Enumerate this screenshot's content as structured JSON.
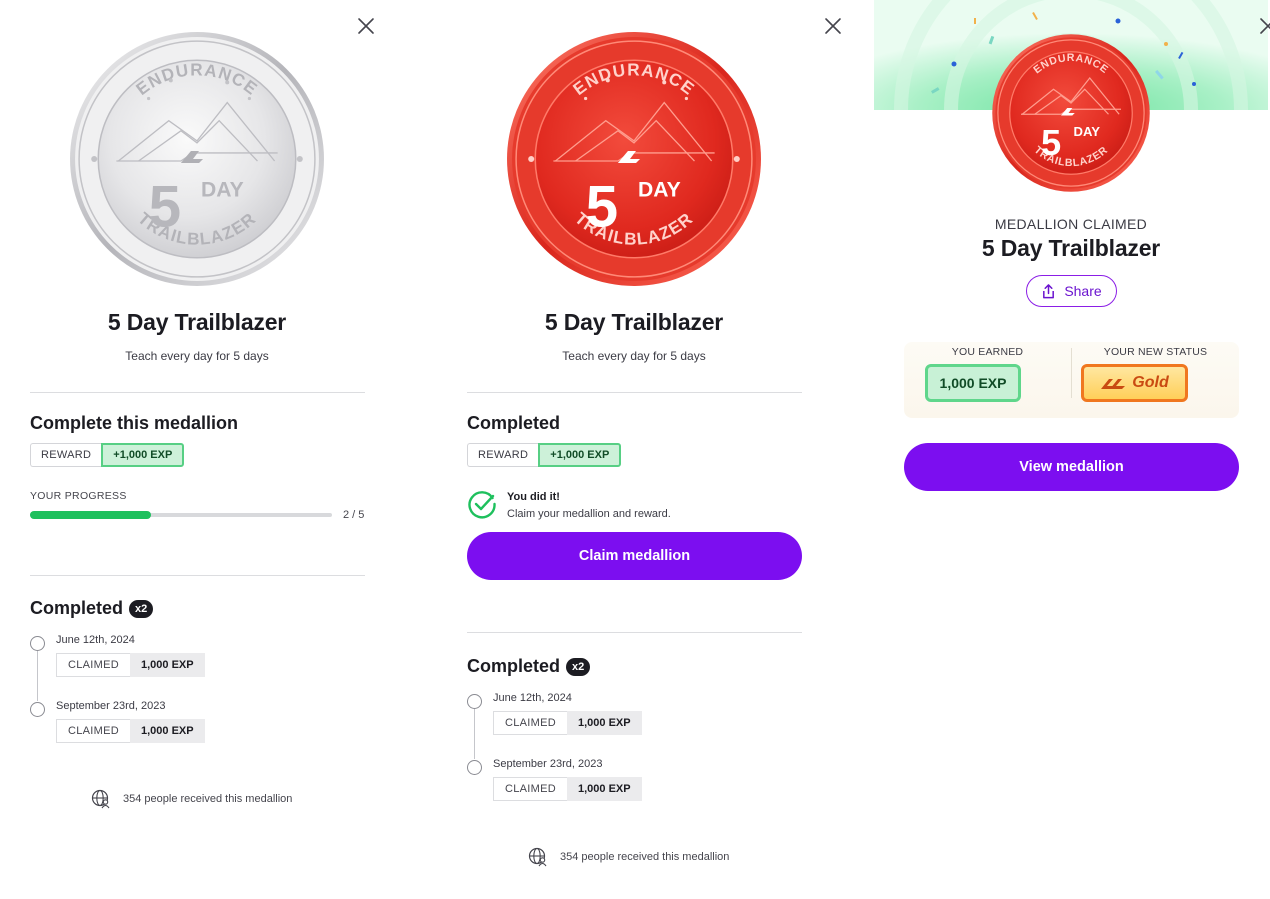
{
  "medallion": {
    "ring_top": "ENDURANCE",
    "ring_bottom": "TRAILBLAZER",
    "number": "5",
    "unit": "DAY"
  },
  "panel1": {
    "title": "5 Day Trailblazer",
    "subtitle": "Teach every day for 5 days",
    "section_title": "Complete this medallion",
    "reward_label": "REWARD",
    "reward_value": "+1,000 EXP",
    "progress_label": "YOUR PROGRESS",
    "progress_text": "2 / 5",
    "progress_fraction": 0.4,
    "completed_title": "Completed",
    "completed_count": "x2",
    "history": [
      {
        "date": "June 12th, 2024",
        "status": "CLAIMED",
        "exp": "1,000 EXP"
      },
      {
        "date": "September 23rd, 2023",
        "status": "CLAIMED",
        "exp": "1,000 EXP"
      }
    ],
    "people_text": "354 people received this medallion"
  },
  "panel2": {
    "title": "5 Day Trailblazer",
    "subtitle": "Teach every day for 5 days",
    "section_title": "Completed",
    "reward_label": "REWARD",
    "reward_value": "+1,000 EXP",
    "done_title": "You did it!",
    "done_text": "Claim your medallion and reward.",
    "cta": "Claim medallion",
    "completed_title": "Completed",
    "completed_count": "x2",
    "history": [
      {
        "date": "June 12th, 2024",
        "status": "CLAIMED",
        "exp": "1,000 EXP"
      },
      {
        "date": "September 23rd, 2023",
        "status": "CLAIMED",
        "exp": "1,000 EXP"
      }
    ],
    "people_text": "354 people received this medallion"
  },
  "panel3": {
    "claimed_label": "MEDALLION CLAIMED",
    "title": "5 Day Trailblazer",
    "share": "Share",
    "earned_header": "YOU EARNED",
    "earned_value": "1,000 EXP",
    "status_header": "YOUR NEW STATUS",
    "status_value": "Gold",
    "cta": "View medallion"
  },
  "colors": {
    "accent": "#7c0ef0",
    "progress": "#1ec05d",
    "reward_border": "#57cf84",
    "medal_red": "#e8352b",
    "medal_silver": "#cfcfd2",
    "gold": "#f0771f"
  },
  "icons": [
    "close-icon",
    "check-circle-icon",
    "globe-people-icon",
    "share-icon",
    "logo-mark-icon"
  ]
}
